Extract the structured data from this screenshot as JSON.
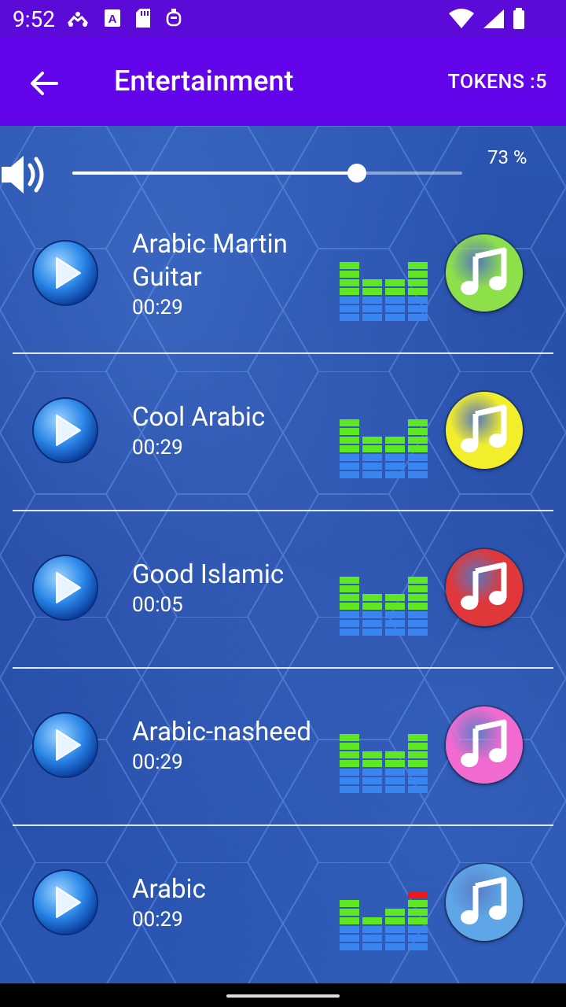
{
  "status": {
    "time": "9:52"
  },
  "appbar": {
    "title": "Entertainment",
    "tokens": "TOKENS :5"
  },
  "volume": {
    "percent_label": "73 %",
    "level": 0.73
  },
  "tracks": [
    {
      "title": "Arabic Martin Guitar",
      "duration": "00:29",
      "note_color": "#8ee04a"
    },
    {
      "title": "Cool Arabic",
      "duration": "00:29",
      "note_color": "#f2ee2c"
    },
    {
      "title": "Good Islamic",
      "duration": "00:05",
      "note_color": "#e0383a"
    },
    {
      "title": "Arabic-nasheed",
      "duration": "00:29",
      "note_color": "#f06ad0"
    },
    {
      "title": "Arabic",
      "duration": "00:29",
      "note_color": "#5ea6e6"
    }
  ],
  "colors": {
    "appbar": "#6205ea",
    "statusbar": "#5b0ad8",
    "eq_green": "#5ee822",
    "eq_blue": "#3a86f0",
    "eq_red": "#f01818"
  }
}
